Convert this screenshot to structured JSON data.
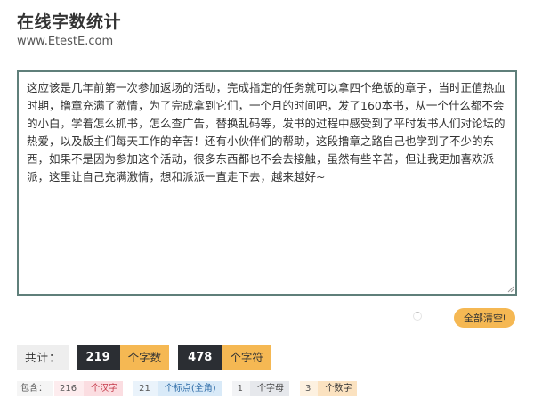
{
  "header": {
    "title": "在线字数统计",
    "url": "www.EtestE.com"
  },
  "editor": {
    "content": "这应该是几年前第一次参加返场的活动，完成指定的任务就可以拿四个绝版的章子，当时正值热血时期，撸章充满了激情，为了完成拿到它们，一个月的时间吧，发了160本书，从一个什么都不会的小白，学着怎么抓书，怎么查广告，替换乱码等，发书的过程中感受到了平时发书人们对论坛的热爱，以及版主们每天工作的辛苦！还有小伙伴们的帮助，这段撸章之路自己也学到了不少的东西，如果不是因为参加这个活动，很多东西都也不会去接触，虽然有些辛苦，但让我更加喜欢派派，这里让自己充满激情，想和派派一直走下去，越来越好~"
  },
  "actions": {
    "clear_label": "全部清空!"
  },
  "stats": {
    "label": "共计：",
    "chars": {
      "value": "219",
      "unit": "个字数"
    },
    "symbols": {
      "value": "478",
      "unit": "个字符"
    }
  },
  "breakdown": {
    "label": "包含：",
    "items": [
      {
        "value": "216",
        "unit": "个汉字"
      },
      {
        "value": "21",
        "unit": "个标点(全角)"
      },
      {
        "value": "1",
        "unit": "个字母"
      },
      {
        "value": "3",
        "unit": "个数字"
      }
    ]
  },
  "colors": {
    "accent": "#f5b853",
    "dark": "#2b2e33",
    "editor_border": "#5f7f7a"
  },
  "icons": [
    "resize-handle-icon",
    "loading-spinner-icon"
  ]
}
